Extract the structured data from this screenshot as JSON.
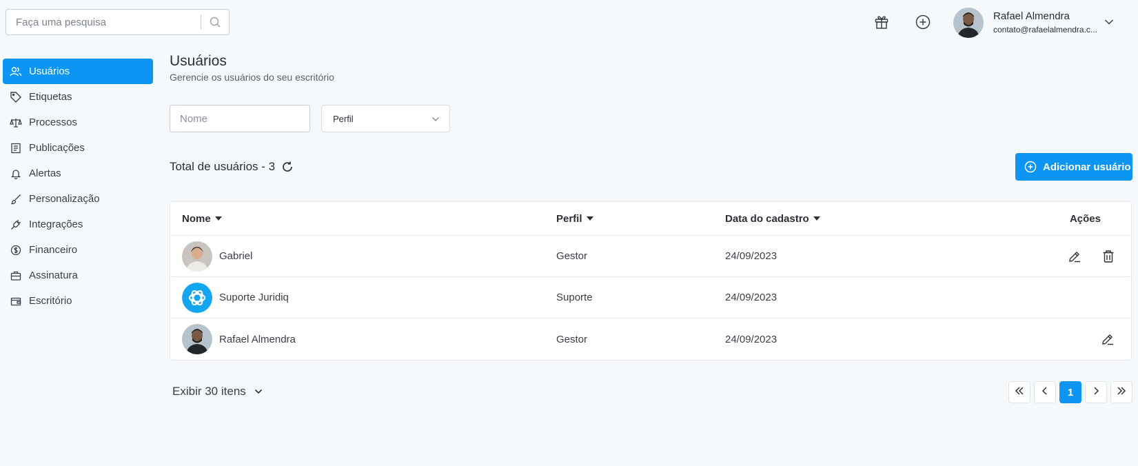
{
  "search": {
    "placeholder": "Faça uma pesquisa"
  },
  "user": {
    "name": "Rafael Almendra",
    "email": "contato@rafaelalmendra.c..."
  },
  "sidebar": {
    "items": [
      {
        "label": "Usuários",
        "icon": "users-icon",
        "active": true
      },
      {
        "label": "Etiquetas",
        "icon": "tag-icon"
      },
      {
        "label": "Processos",
        "icon": "scale-icon"
      },
      {
        "label": "Publicações",
        "icon": "newspaper-icon"
      },
      {
        "label": "Alertas",
        "icon": "bell-icon"
      },
      {
        "label": "Personalização",
        "icon": "brush-icon"
      },
      {
        "label": "Integrações",
        "icon": "plug-icon"
      },
      {
        "label": "Financeiro",
        "icon": "dollar-icon"
      },
      {
        "label": "Assinatura",
        "icon": "briefcase-icon"
      },
      {
        "label": "Escritório",
        "icon": "wallet-icon"
      }
    ]
  },
  "main": {
    "title": "Usuários",
    "subtitle": "Gerencie os usuários do seu escritório",
    "filters": {
      "name_placeholder": "Nome",
      "perfil_label": "Perfil"
    },
    "total_label": "Total de usuários - 3",
    "add_button": "Adicionar usuário"
  },
  "table": {
    "headers": {
      "nome": "Nome",
      "perfil": "Perfil",
      "data": "Data do cadastro",
      "acoes": "Ações"
    },
    "rows": [
      {
        "name": "Gabriel",
        "perfil": "Gestor",
        "data": "24/09/2023",
        "avatar": "photo",
        "actions": [
          "edit",
          "delete"
        ]
      },
      {
        "name": "Suporte Juridiq",
        "perfil": "Suporte",
        "data": "24/09/2023",
        "avatar": "logo",
        "actions": []
      },
      {
        "name": "Rafael Almendra",
        "perfil": "Gestor",
        "data": "24/09/2023",
        "avatar": "photo",
        "actions": [
          "edit"
        ]
      }
    ]
  },
  "pagination": {
    "per_page_label": "Exibir 30 itens",
    "current_page": "1"
  },
  "colors": {
    "accent": "#0c95f2",
    "background": "#f6f9fc"
  }
}
